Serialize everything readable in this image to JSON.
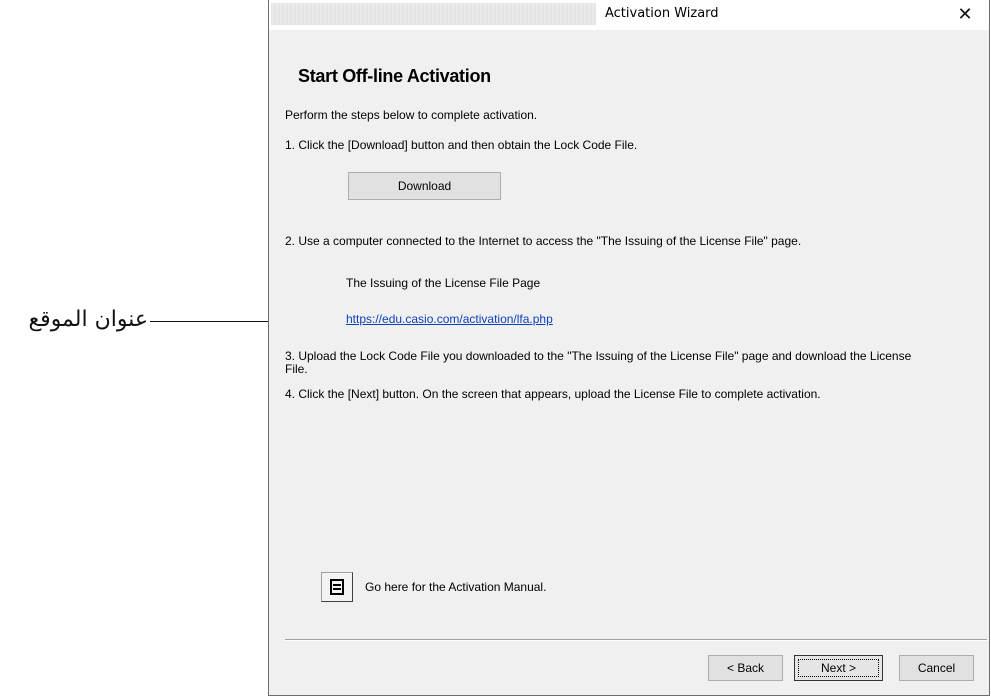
{
  "annotation": {
    "label": "عنوان الموقع"
  },
  "window": {
    "title": "Activation Wizard",
    "close_glyph": "✕"
  },
  "content": {
    "heading": "Start Off-line Activation",
    "intro": "Perform the steps below to complete activation.",
    "step1": "1. Click the [Download] button and then obtain the Lock Code File.",
    "download_label": "Download",
    "step2": "2. Use a computer connected to the Internet to access the \"The Issuing of the License File\" page.",
    "license_page_title": "The Issuing of the License File Page",
    "license_url": "https://edu.casio.com/activation/lfa.php",
    "step3_line1": "3. Upload the Lock Code File you downloaded to the \"The Issuing of the License File\" page and download the License",
    "step3_line2": "File.",
    "step4": "4. Click the [Next] button. On the screen that appears, upload the License File to complete activation.",
    "manual_text": "Go here for the Activation Manual.",
    "manual_icon": "document-icon"
  },
  "footer": {
    "back_label": "< Back",
    "next_label": "Next >",
    "cancel_label": "Cancel"
  }
}
